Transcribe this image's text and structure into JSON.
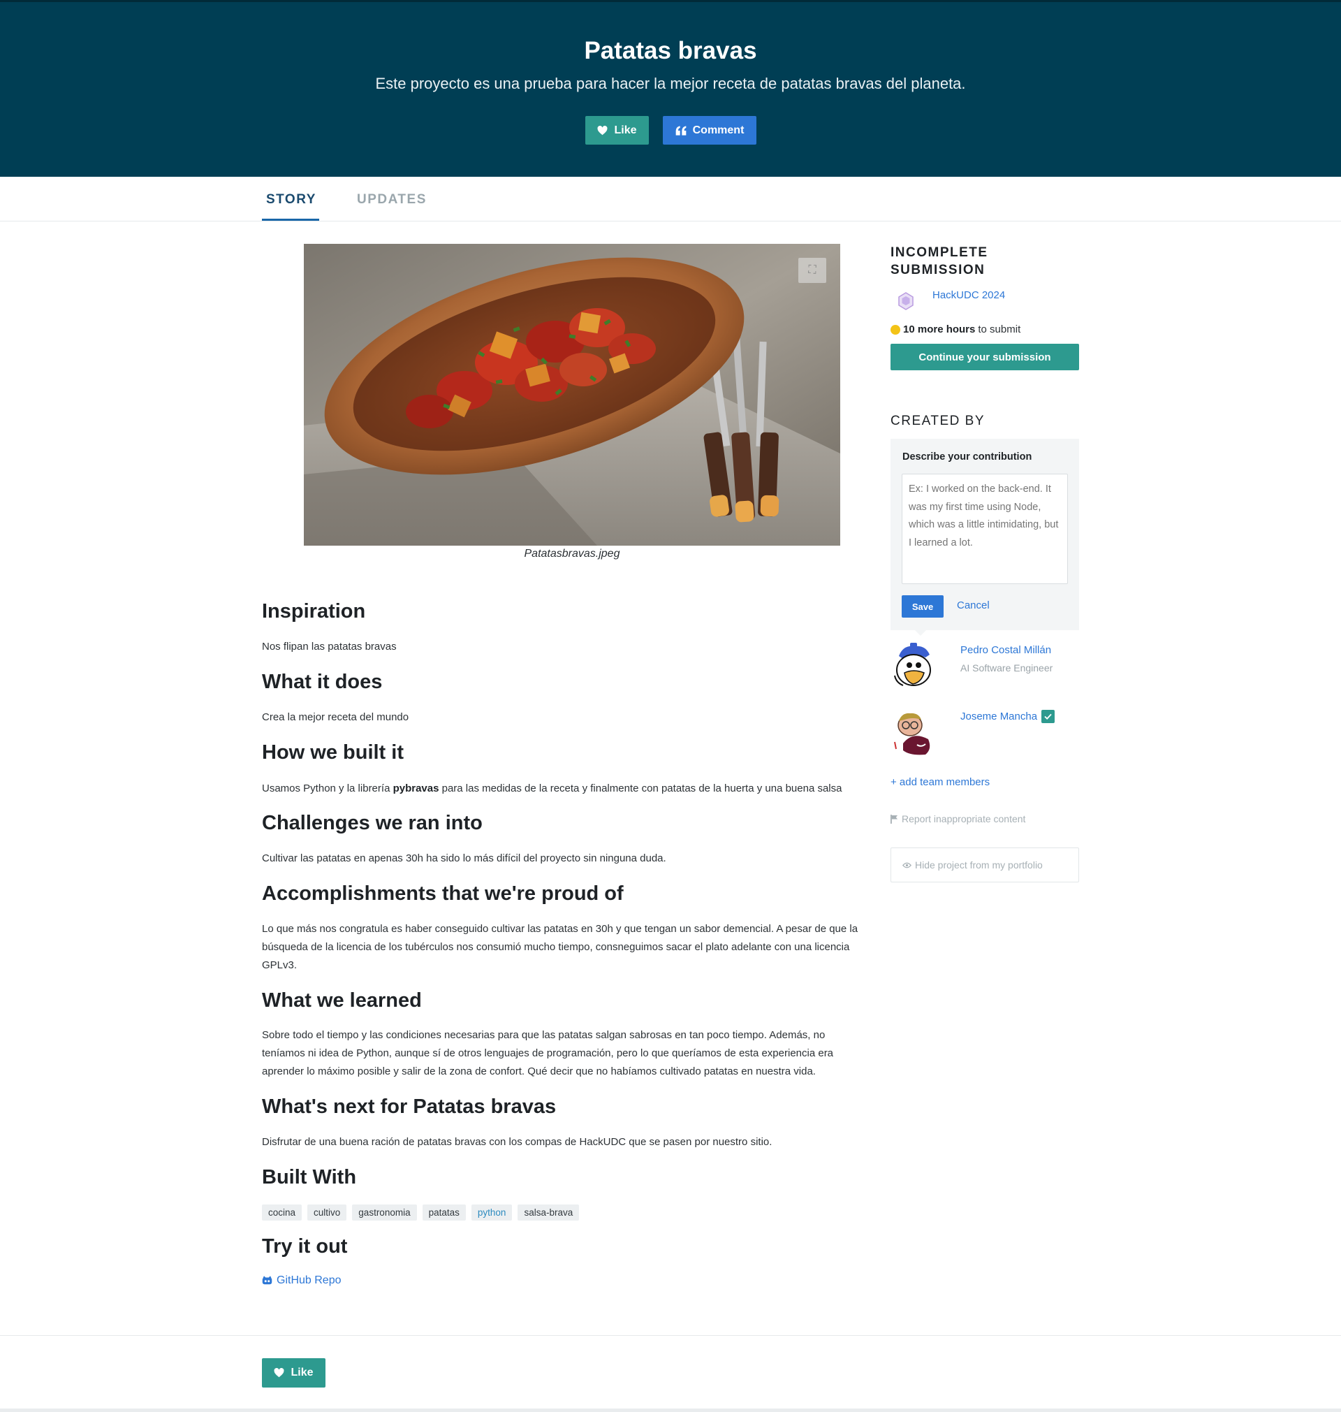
{
  "header": {
    "title": "Patatas bravas",
    "tagline": "Este proyecto es una prueba para hacer la mejor receta de patatas bravas del planeta.",
    "like_label": "Like",
    "comment_label": "Comment"
  },
  "tabs": [
    {
      "label": "STORY",
      "active": true
    },
    {
      "label": "UPDATES",
      "active": false
    }
  ],
  "gallery": {
    "caption": "Patatasbravas.jpeg"
  },
  "story": [
    {
      "heading": "Inspiration",
      "body": "Nos flipan las patatas bravas"
    },
    {
      "heading": "What it does",
      "body": "Crea la mejor receta del mundo"
    },
    {
      "heading": "How we built it",
      "body_before": "Usamos Python y la librería ",
      "body_bold": "pybravas",
      "body_after": " para las medidas de la receta y finalmente con patatas de la huerta y una buena salsa"
    },
    {
      "heading": "Challenges we ran into",
      "body": "Cultivar las patatas en apenas 30h ha sido lo más difícil del proyecto sin ninguna duda."
    },
    {
      "heading": "Accomplishments that we're proud of",
      "body": "Lo que más nos congratula es haber conseguido cultivar las patatas en 30h y que tengan un sabor demencial. A pesar de que la búsqueda de la licencia de los tubérculos nos consumió mucho tiempo, consneguimos sacar el plato adelante con una licencia GPLv3."
    },
    {
      "heading": "What we learned",
      "body": "Sobre todo el tiempo y las condiciones necesarias para que las patatas salgan sabrosas en tan poco tiempo. Además, no teníamos ni idea de Python, aunque sí de otros lenguajes de programación, pero lo que queríamos de esta experiencia era aprender lo máximo posible y salir de la zona de confort. Qué decir que no habíamos cultivado patatas en nuestra vida."
    },
    {
      "heading": "What's next for Patatas bravas",
      "body": "Disfrutar de una buena ración de patatas bravas con los compas de HackUDC que se pasen por nuestro sitio."
    }
  ],
  "built_with": {
    "heading": "Built With",
    "tags": [
      {
        "label": "cocina",
        "link": false
      },
      {
        "label": "cultivo",
        "link": false
      },
      {
        "label": "gastronomia",
        "link": false
      },
      {
        "label": "patatas",
        "link": false
      },
      {
        "label": "python",
        "link": true
      },
      {
        "label": "salsa-brava",
        "link": false
      }
    ]
  },
  "try_it_out": {
    "heading": "Try it out",
    "link_label": "GitHub Repo"
  },
  "bottom": {
    "like_label": "Like"
  },
  "sidebar": {
    "submission_heading_line1": "INCOMPLETE",
    "submission_heading_line2": "SUBMISSION",
    "hackathon_name": "HackUDC 2024",
    "deadline_bold": "10 more hours",
    "deadline_rest": "to submit",
    "continue_label": "Continue your submission",
    "created_by_heading": "CREATED BY",
    "contribution": {
      "label": "Describe your contribution",
      "placeholder": "Ex: I worked on the back-end. It was my first time using Node, which was a little intimidating, but I learned a lot.",
      "save_label": "Save",
      "cancel_label": "Cancel"
    },
    "members": [
      {
        "name": "Pedro Costal Millán",
        "role": "AI Software Engineer",
        "verified": false
      },
      {
        "name": "Joseme Mancha",
        "role": "",
        "verified": true
      }
    ],
    "add_members_label": "+ add team members",
    "report_label": "Report inappropriate content",
    "hide_label": "Hide project from my portfolio"
  },
  "colors": {
    "header_bg": "#003e54",
    "teal": "#2d9a8f",
    "blue": "#2d77d6"
  }
}
